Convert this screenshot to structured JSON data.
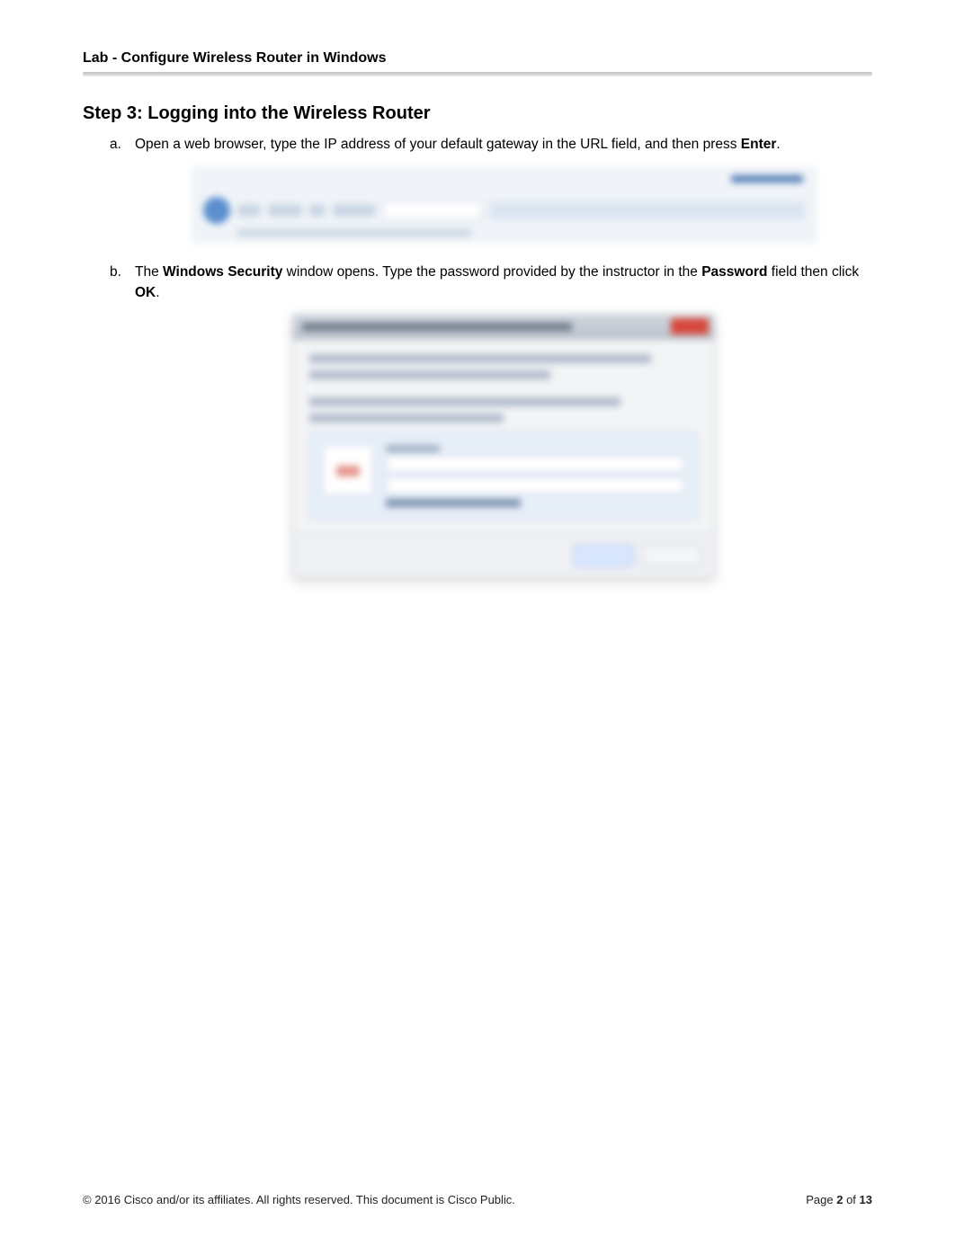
{
  "header": {
    "title": "Lab - Configure Wireless Router in Windows"
  },
  "step": {
    "heading": "Step 3:  Logging into the Wireless Router",
    "items": [
      {
        "marker": "a.",
        "pre": "Open a web browser, type the IP address of your default gateway in the URL field, and then press ",
        "bold1": "Enter",
        "post": "."
      },
      {
        "marker": "b.",
        "pre": "The ",
        "bold1": "Windows Security",
        "mid1": " window opens. Type the password provided by the instructor in the ",
        "bold2": "Password",
        "mid2": " field then click ",
        "bold3": "OK",
        "post": "."
      }
    ]
  },
  "footer": {
    "copyright": "© 2016 Cisco and/or its affiliates. All rights reserved. This document is Cisco Public.",
    "page_label_pre": "Page ",
    "page_current": "2",
    "page_of": " of ",
    "page_total": "13"
  }
}
